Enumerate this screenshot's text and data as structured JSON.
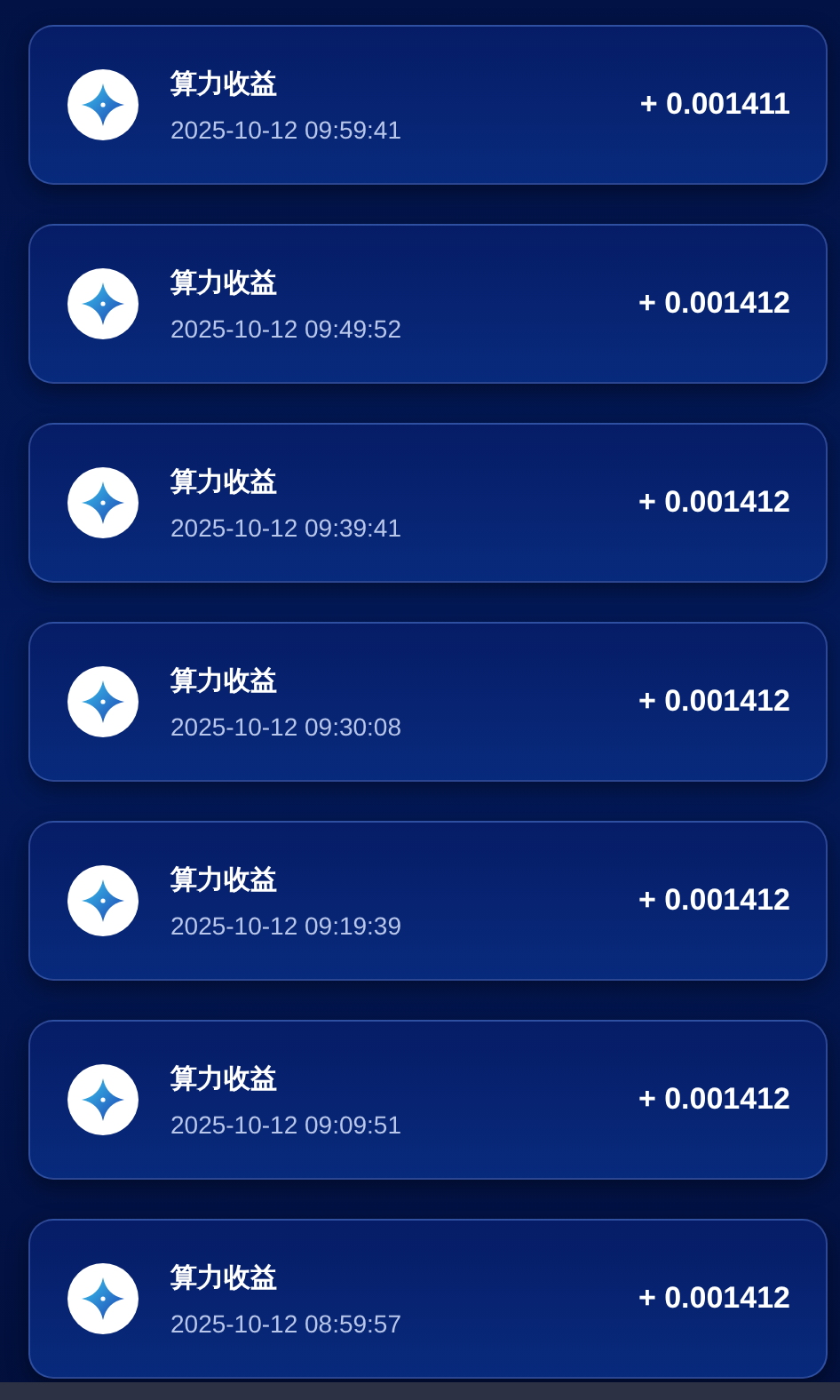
{
  "records": [
    {
      "title": "算力收益",
      "time": "2025-10-12 09:59:41",
      "amount": "+ 0.001411"
    },
    {
      "title": "算力收益",
      "time": "2025-10-12 09:49:52",
      "amount": "+ 0.001412"
    },
    {
      "title": "算力收益",
      "time": "2025-10-12 09:39:41",
      "amount": "+ 0.001412"
    },
    {
      "title": "算力收益",
      "time": "2025-10-12 09:30:08",
      "amount": "+ 0.001412"
    },
    {
      "title": "算力收益",
      "time": "2025-10-12 09:19:39",
      "amount": "+ 0.001412"
    },
    {
      "title": "算力收益",
      "time": "2025-10-12 09:09:51",
      "amount": "+ 0.001412"
    },
    {
      "title": "算力收益",
      "time": "2025-10-12 08:59:57",
      "amount": "+ 0.001412"
    }
  ]
}
